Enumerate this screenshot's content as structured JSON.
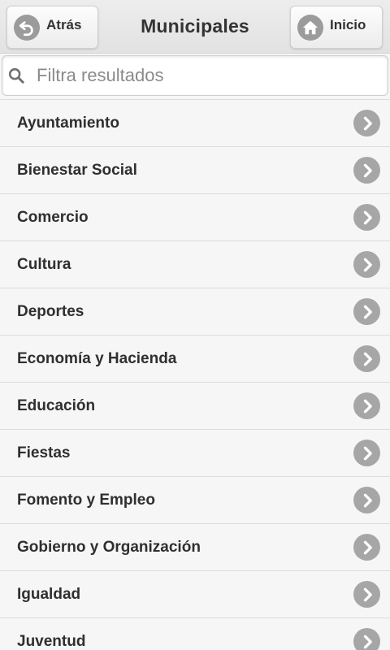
{
  "header": {
    "title": "Municipales",
    "back_label": "Atrás",
    "home_label": "Inicio"
  },
  "search": {
    "placeholder": "Filtra resultados",
    "value": ""
  },
  "list": {
    "items": [
      {
        "label": "Ayuntamiento"
      },
      {
        "label": "Bienestar Social"
      },
      {
        "label": "Comercio"
      },
      {
        "label": "Cultura"
      },
      {
        "label": "Deportes"
      },
      {
        "label": "Economía y Hacienda"
      },
      {
        "label": "Educación"
      },
      {
        "label": "Fiestas"
      },
      {
        "label": "Fomento y Empleo"
      },
      {
        "label": "Gobierno y Organización"
      },
      {
        "label": "Igualdad"
      },
      {
        "label": "Juventud"
      }
    ]
  },
  "icons": {
    "back": "back-arrow-icon",
    "home": "home-icon",
    "search": "search-icon",
    "row": "chevron-right-icon"
  },
  "colors": {
    "header_bg": "#e6e6e6",
    "icon_gray": "#9b9b9b",
    "text": "#2f2f2f"
  }
}
